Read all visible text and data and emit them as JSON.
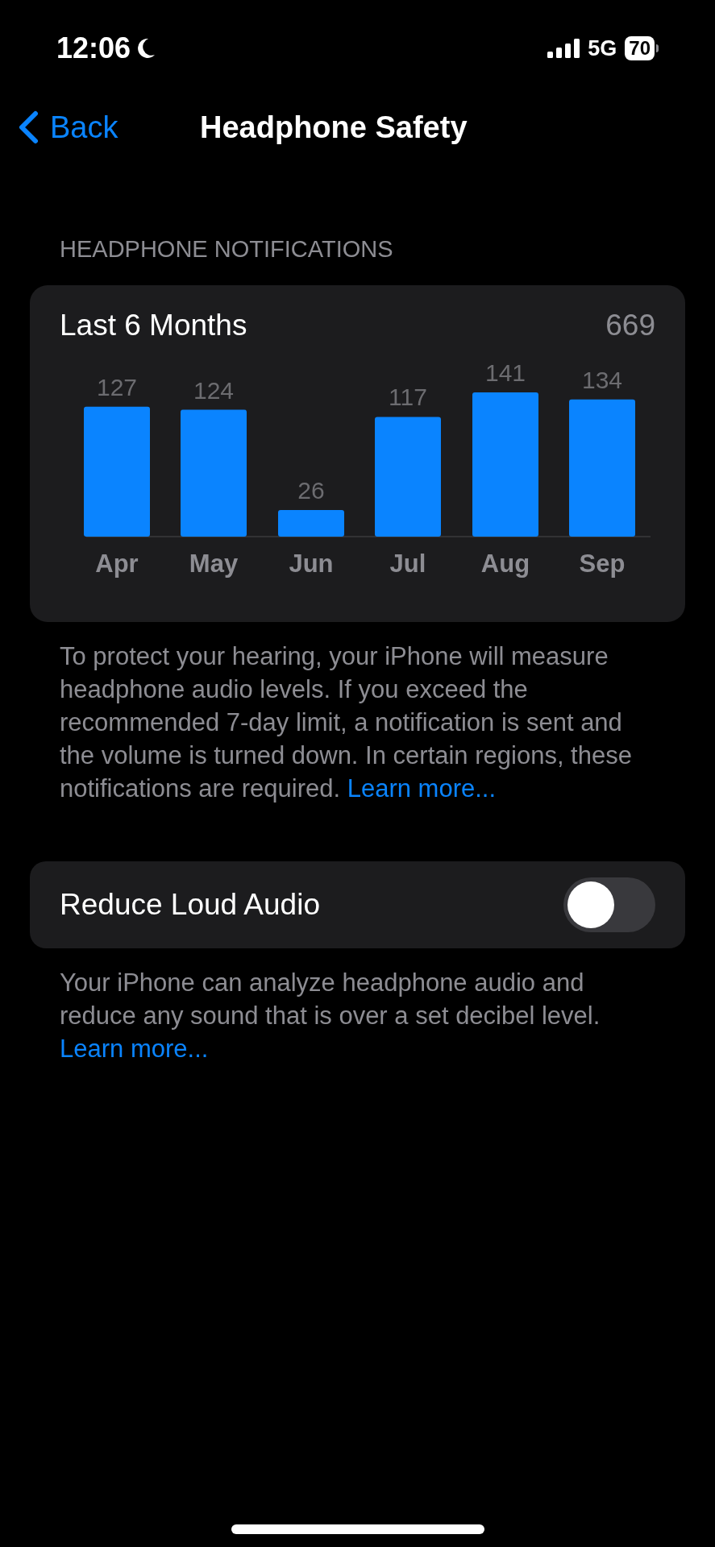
{
  "status_bar": {
    "time": "12:06",
    "network": "5G",
    "battery": "70"
  },
  "nav": {
    "back": "Back",
    "title": "Headphone Safety"
  },
  "notifications": {
    "header": "HEADPHONE NOTIFICATIONS",
    "period": "Last 6 Months",
    "total": "669",
    "chart_data": {
      "type": "bar",
      "categories": [
        "Apr",
        "May",
        "Jun",
        "Jul",
        "Aug",
        "Sep"
      ],
      "values": [
        127,
        124,
        26,
        117,
        141,
        134
      ],
      "data_labels": true
    },
    "footer": {
      "text": "To protect your hearing, your iPhone will measure headphone audio levels. If you exceed the recommended 7-day limit, a notification is sent and the volume is turned down. In certain regions, these notifications are required.",
      "link": "Learn more..."
    }
  },
  "reduce_loud_audio": {
    "label": "Reduce Loud Audio",
    "on": false,
    "footer": {
      "text": "Your iPhone can analyze headphone audio and reduce any sound that is over a set decibel level.",
      "link": "Learn more..."
    }
  }
}
